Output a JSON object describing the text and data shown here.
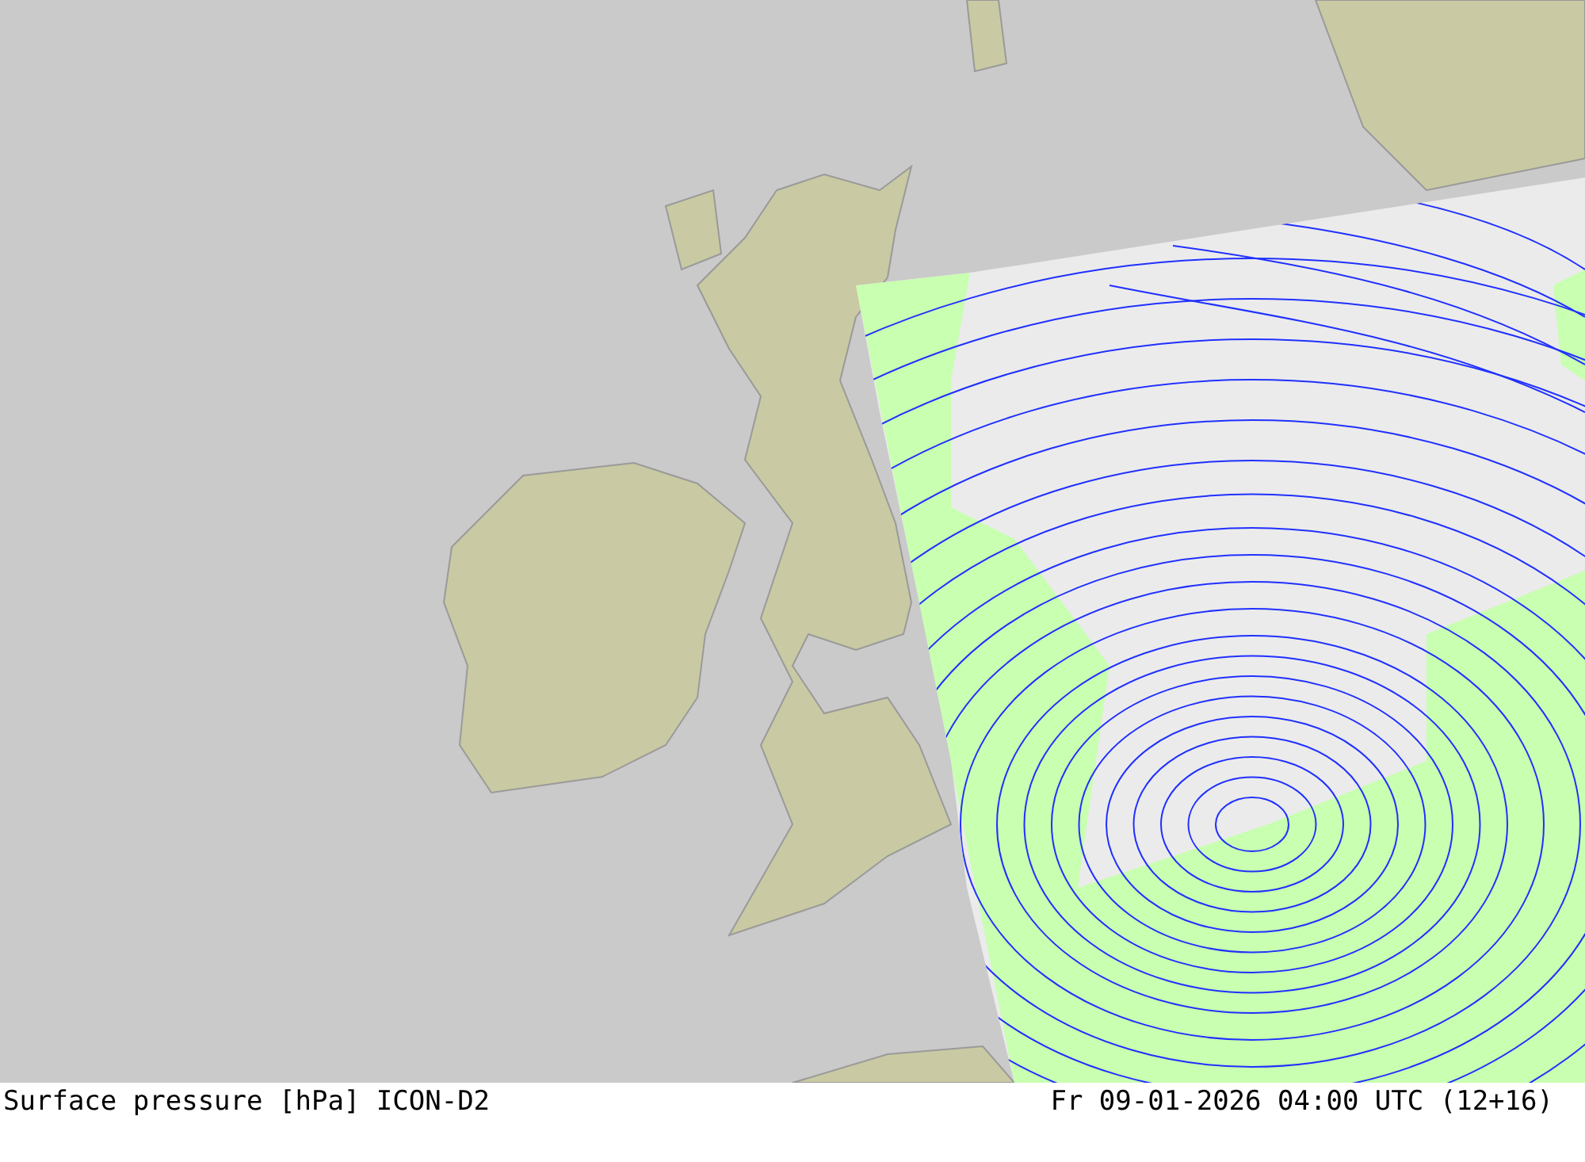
{
  "map": {
    "caption": {
      "title": "Surface pressure [hPa] ICON-D2",
      "valid_time": "Fr 09-01-2026 04:00 UTC (12+16)"
    }
  }
}
